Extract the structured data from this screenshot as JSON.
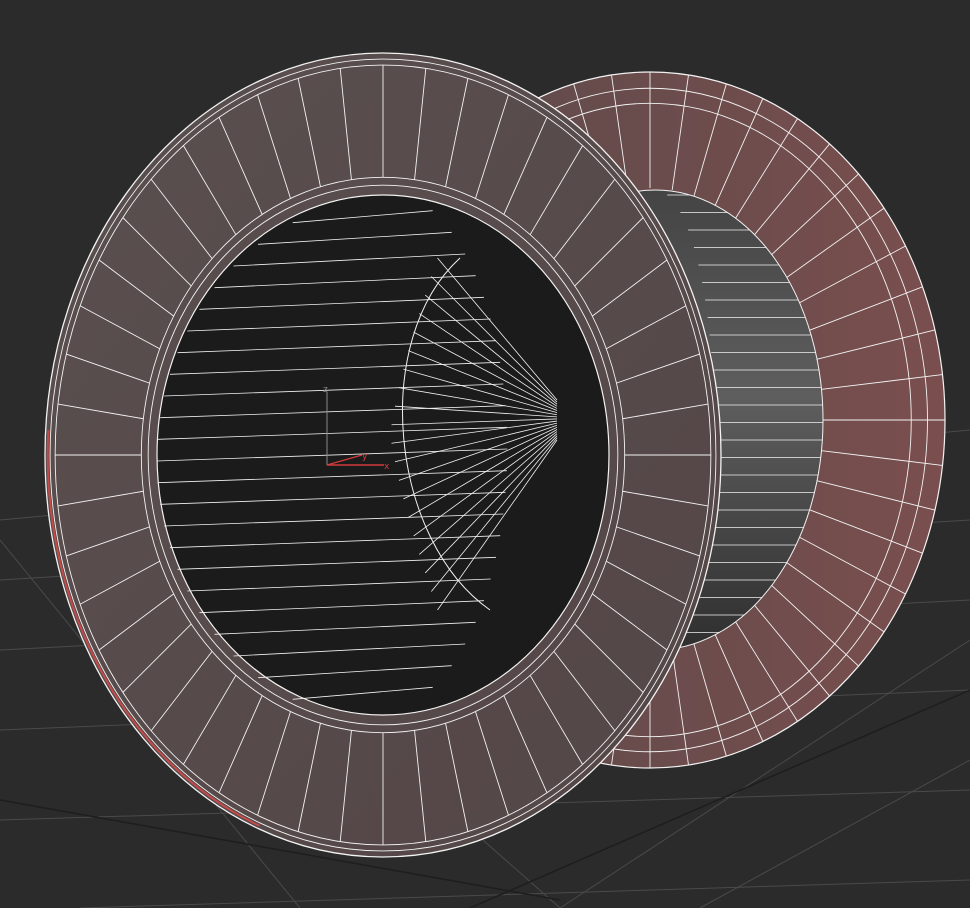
{
  "viewport": {
    "background": "#2b2b2b",
    "grid_color": "#4a4a4a",
    "grid_dark_color": "#1e1e1e",
    "wire_color": "#f2f2f2",
    "selection_edge_color": "#c44a4a"
  },
  "model": {
    "radial_segments": 48,
    "front_ring_color": "#564a4a",
    "back_ring_color": "#6e4c4c",
    "inner_hole_color": "#1b1b1b",
    "inner_wall_color": "#5b5b5b",
    "inner_strip_count": 24
  },
  "gizmo": {
    "labels": {
      "x": "x",
      "y": "y",
      "z": "z"
    },
    "x_color": "#d23a3a",
    "y_color": "#d23a3a",
    "z_color": "#8a8a8a"
  }
}
